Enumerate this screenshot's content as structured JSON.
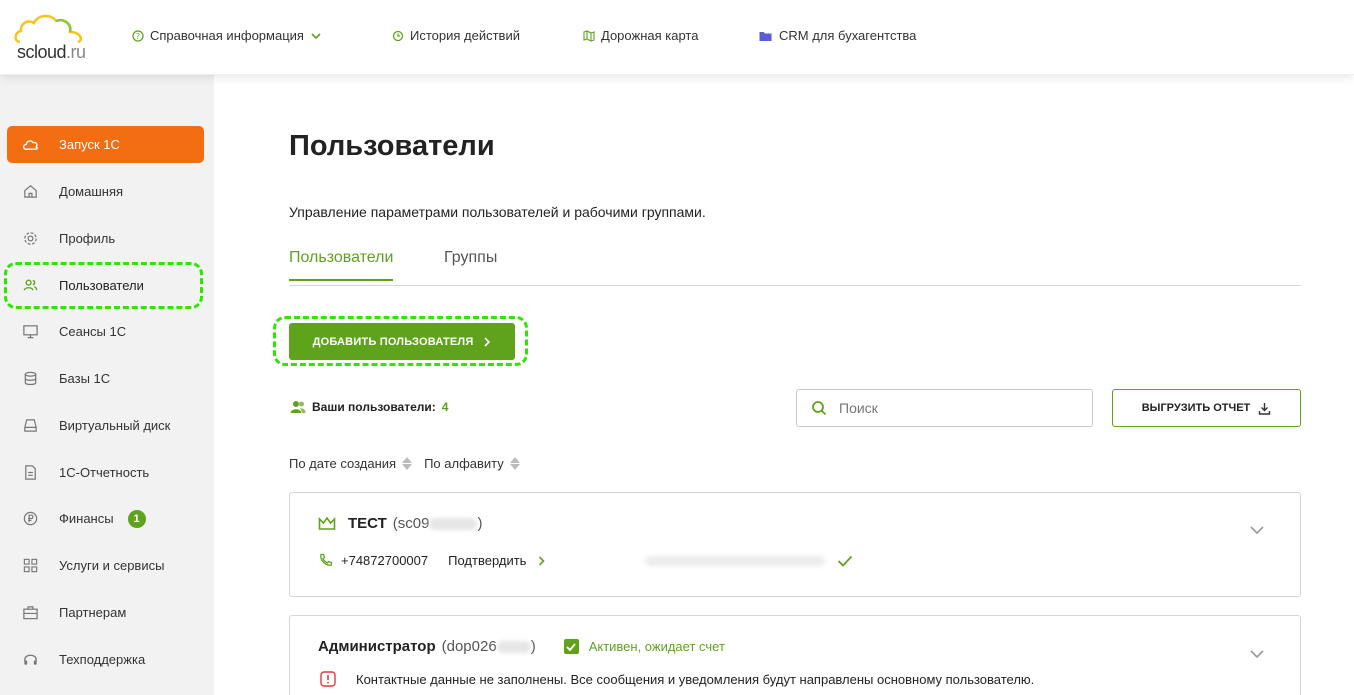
{
  "logo": {
    "text_main": "scloud",
    "text_ru": ".ru"
  },
  "topnav": [
    {
      "label": "Справочная информация",
      "icon": "help-circle-icon"
    },
    {
      "label": "История действий",
      "icon": "history-icon"
    },
    {
      "label": "Дорожная карта",
      "icon": "map-icon"
    },
    {
      "label": "CRM для бухагентства",
      "icon": "folder-icon"
    }
  ],
  "sidebar": {
    "items": [
      {
        "label": "Запуск 1С",
        "icon": "cloud-icon"
      },
      {
        "label": "Домашняя",
        "icon": "home-icon"
      },
      {
        "label": "Профиль",
        "icon": "gear-icon"
      },
      {
        "label": "Пользователи",
        "icon": "users-icon"
      },
      {
        "label": "Сеансы 1С",
        "icon": "monitor-icon"
      },
      {
        "label": "Базы 1С",
        "icon": "database-icon"
      },
      {
        "label": "Виртуальный диск",
        "icon": "disk-icon"
      },
      {
        "label": "1С-Отчетность",
        "icon": "document-icon"
      },
      {
        "label": "Финансы",
        "icon": "ruble-icon",
        "badge": "1"
      },
      {
        "label": "Услуги и сервисы",
        "icon": "grid-icon"
      },
      {
        "label": "Партнерам",
        "icon": "briefcase-icon"
      },
      {
        "label": "Техподдержка",
        "icon": "headset-icon"
      }
    ]
  },
  "main": {
    "title": "Пользователи",
    "description": "Управление параметрами пользователей и рабочими группами.",
    "tabs": [
      {
        "label": "Пользователи"
      },
      {
        "label": "Группы"
      }
    ],
    "add_button": "ДОБАВИТЬ ПОЛЬЗОВАТЕЛЯ",
    "users_count_label": "Ваши пользователи:",
    "users_count": "4",
    "search_placeholder": "Поиск",
    "export_button": "ВЫГРУЗИТЬ ОТЧЕТ",
    "sorts": [
      {
        "label": "По дате создания"
      },
      {
        "label": "По алфавиту"
      }
    ],
    "users": [
      {
        "name": "ТЕСТ",
        "login_prefix": "(sc09",
        "login_suffix": ")",
        "phone": "+74872700007",
        "confirm": "Подтвердить"
      },
      {
        "name": "Администратор",
        "login_prefix": "(dop026",
        "login_suffix": ")",
        "status": "Активен, ожидает счет",
        "warning": "Контактные данные не заполнены. Все сообщения и уведомления будут направлены основному пользователю."
      }
    ]
  },
  "colors": {
    "accent_green": "#5fa31c",
    "accent_orange": "#f36d12",
    "highlight": "#2ee600"
  }
}
